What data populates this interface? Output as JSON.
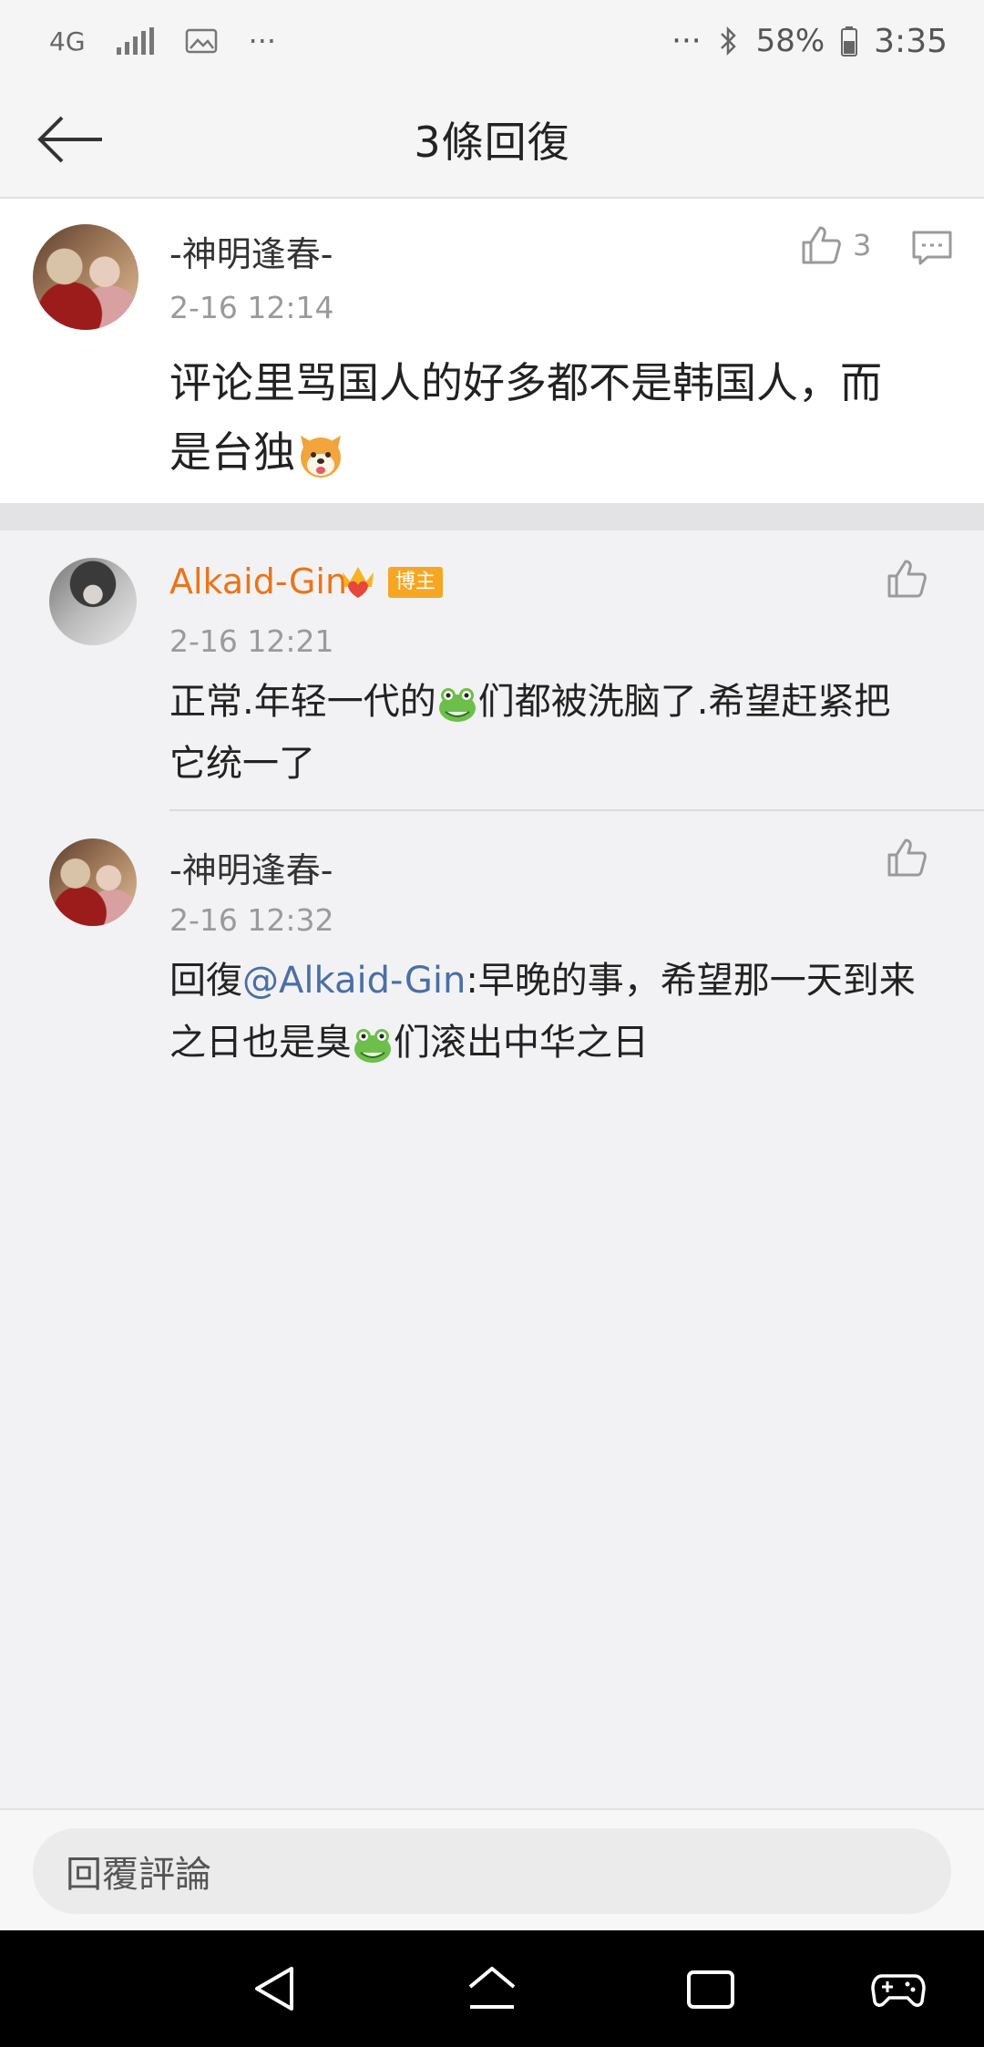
{
  "status_bar": {
    "network": "4G",
    "more": "···",
    "right_more": "···",
    "battery": "58%",
    "time": "3:35"
  },
  "header": {
    "title": "3條回復"
  },
  "main_comment": {
    "user": "-神明逢春-",
    "time": "2-16 12:14",
    "like_count": "3",
    "text_line1": "评论里骂国人的好多都不是韩国人，而",
    "text_line2": "是台独",
    "emoji": "dog-emoji"
  },
  "replies": [
    {
      "user": "Alkaid-Gin",
      "badge": "博主",
      "time": "2-16 12:21",
      "text_a": "正常.年轻一代的",
      "text_b": "们都被洗脑了.希望赶紧把",
      "text_line2": "它统一了"
    },
    {
      "user": "-神明逢春-",
      "time": "2-16 12:32",
      "prefix": "回復",
      "mention": "@Alkaid-Gin",
      "text_a": ":早晚的事，希望那一天到来",
      "text_b": "之日也是臭",
      "text_c": "们滚出中华之日"
    }
  ],
  "input_bar": {
    "placeholder": "回覆評論"
  },
  "colors": {
    "accent_orange": "#eb7417",
    "mention_blue": "#4a6fa5",
    "badge_orange": "#f5a623"
  }
}
